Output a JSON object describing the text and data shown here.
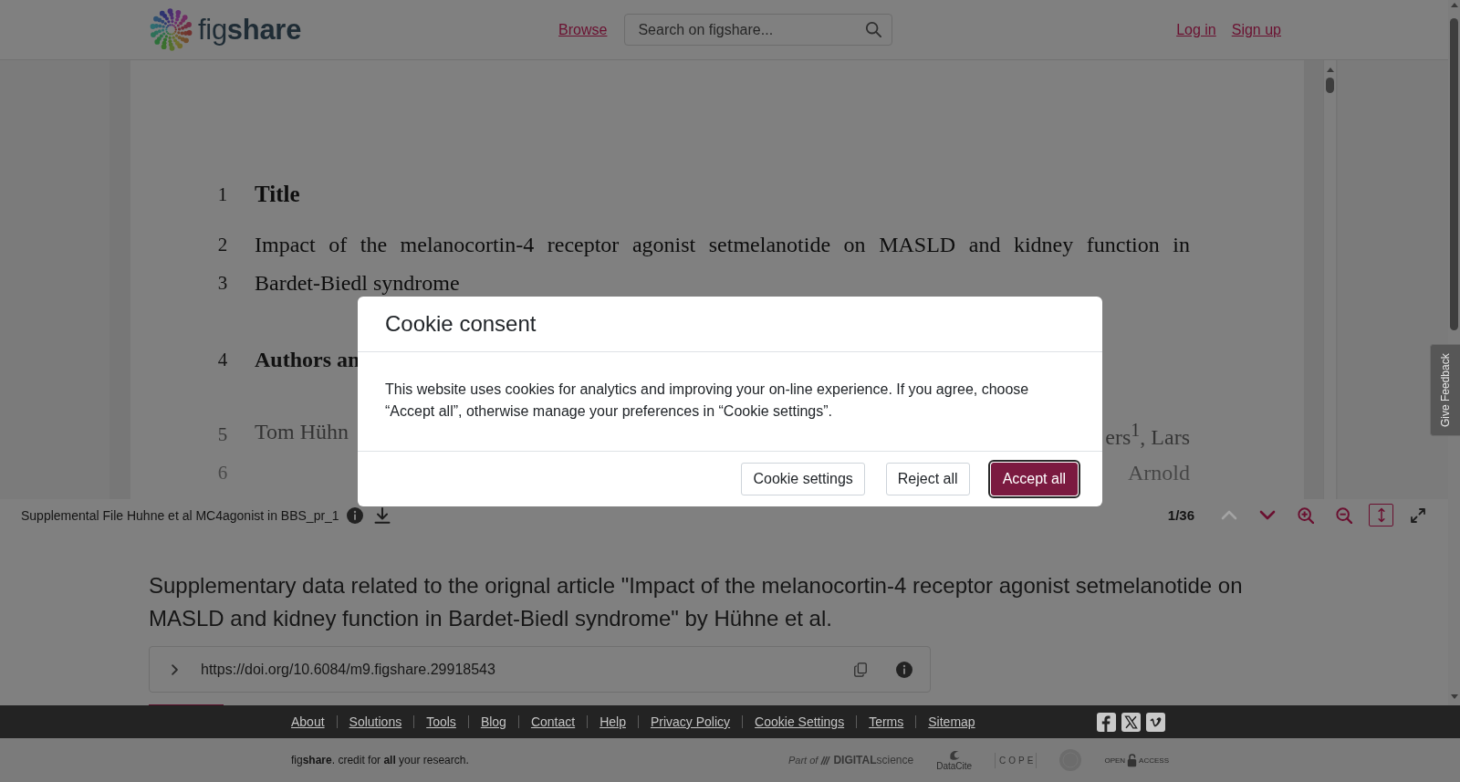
{
  "header": {
    "logo": "fig**share**",
    "nav_link": "Browse",
    "search": {
      "placeholder": "Search on figshare..."
    },
    "account_links": [
      "Log in",
      "Sign up"
    ]
  },
  "viewer": {
    "document": {
      "paragraphs": [
        {
          "kind": "title",
          "lines": [
            {
              "number": "1",
              "text": "Title"
            }
          ]
        },
        {
          "kind": "body",
          "lines": [
            {
              "number": "2",
              "text": "Impact of the melanocortin-4 receptor agonist setmelanotide on MASLD and kidney function in"
            },
            {
              "number": "3",
              "text": "Bardet-Biedl syndrome"
            }
          ]
        },
        {
          "kind": "heading",
          "lines": [
            {
              "number": "4",
              "text": "Authors an"
            }
          ]
        },
        {
          "kind": "body",
          "lines": [
            {
              "number": "5",
              "text": "Tom Hühn",
              "text_end": "ers$^{1}$, Lars"
            },
            {
              "number": "6",
              "text_end": "Arnold"
            }
          ]
        }
      ]
    },
    "toolbar": {
      "file_name": "Supplemental File Huhne et al MC4agonist in BBS_pr_1",
      "file_actions": [
        {
          "kind": "info"
        },
        {
          "kind": "download"
        }
      ],
      "page_indicator": "1/36",
      "controls": [
        {
          "kind": "previous-page",
          "disabled": true
        },
        {
          "kind": "next-page",
          "disabled": false
        },
        {
          "kind": "zoom-in"
        },
        {
          "kind": "zoom-out"
        },
        {
          "kind": "fit-height",
          "active": true
        },
        {
          "kind": "fullscreen",
          "active": false
        }
      ]
    }
  },
  "description": "Supplementary data related to the orignal article \"Impact of the melanocortin-4 receptor agonist setmelanotide on MASLD and kidney function in Bardet-Biedl syndrome\" by Hühne et al.",
  "doi": {
    "expanded": false,
    "url": "https://doi.org/10.6084/m9.figshare.29918543",
    "actions": [
      {
        "kind": "copy"
      },
      {
        "kind": "info"
      }
    ]
  },
  "feedback_tab": "Give Feedback",
  "footer": {
    "links": [
      "About",
      "Solutions",
      "Tools",
      "Blog",
      "Contact",
      "Help",
      "Privacy Policy",
      "Cookie Settings",
      "Terms",
      "Sitemap"
    ],
    "social": [
      {
        "kind": "facebook"
      },
      {
        "kind": "x"
      },
      {
        "kind": "vimeo"
      }
    ],
    "tagline": "fig**share**. credit for **all** your research.",
    "partners": [
      {
        "kind": "digital-science",
        "texts": [
          "Part of",
          "**DIGITAL**science"
        ]
      },
      {
        "kind": "datacite",
        "texts": [
          "DataCite"
        ]
      },
      {
        "kind": "cope",
        "texts": [
          "COPE"
        ]
      },
      {
        "kind": "seal"
      },
      {
        "kind": "open-access",
        "texts": [
          "OPEN",
          "ACCESS"
        ]
      }
    ]
  },
  "cookie_dialog": {
    "title": "Cookie consent",
    "message": "This website uses cookies for analytics and improving your on-line experience. If you agree, choose “Accept all”, otherwise manage your preferences in “Cookie settings”.",
    "buttons": [
      {
        "label": "Cookie settings",
        "kind": "secondary",
        "focused": false
      },
      {
        "label": "Reject all",
        "kind": "secondary",
        "focused": false
      },
      {
        "label": "Accept all",
        "kind": "primary",
        "focused": true
      }
    ]
  }
}
